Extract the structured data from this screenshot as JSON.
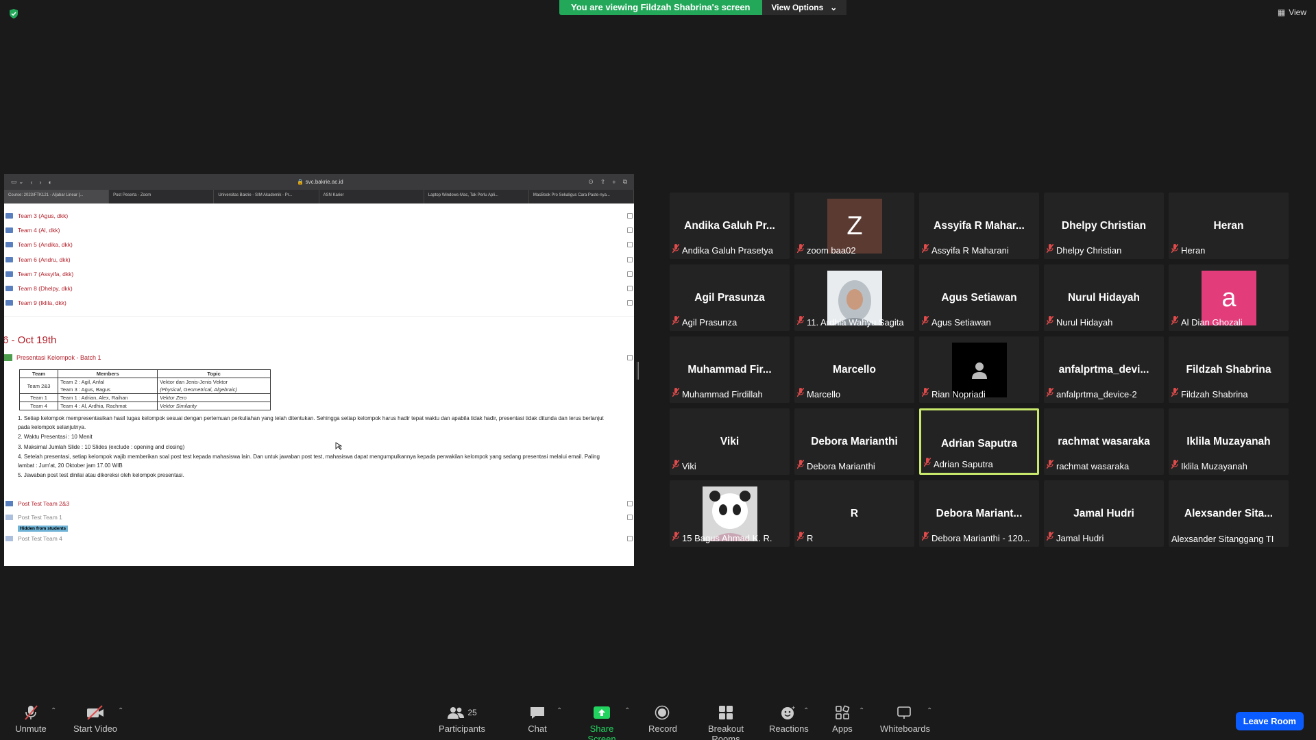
{
  "banner": {
    "viewing": "You are viewing Fildzah Shabrina's screen",
    "options": "View Options"
  },
  "view_label": "View",
  "browser": {
    "url": "svc.bakrie.ac.id",
    "tabs": [
      "Course: 2023/FTK121 - Aljabar Linear [...",
      "Post Peserta - Zoom",
      "Universitas Bakrie - SIM Akademik - Pr...",
      "ASN Karier",
      "Laptop Windows-Mac, Tak Perlu Apli...",
      "MacBook Pro Sekaligus Cara Paste-nya..."
    ]
  },
  "course": {
    "teams": [
      "Team 3 (Agus, dkk)",
      "Team 4 (Al, dkk)",
      "Team 5 (Andika, dkk)",
      "Team 6 (Andru, dkk)",
      "Team 7 (Assyifa, dkk)",
      "Team 8 (Dhelpy, dkk)",
      "Team 9 (Iklila, dkk)"
    ],
    "section_title": "6 - Oct 19th",
    "presentation_link": "Presentasi Kelompok - Batch 1",
    "table": {
      "headers": [
        "Team",
        "Members",
        "Topic"
      ],
      "rows": [
        {
          "team": "Team 2&3",
          "m1": "Team 2 : Agil, Anfal",
          "m2": "Team 3 : Agus, Bagus",
          "t1": "Vektor dan Jenis-Jenis Vektor",
          "t2": "(Physical, Geometrical, Algebraic)"
        },
        {
          "team": "Team 1",
          "m1": "Team 1 : Adrian, Alex, Raihan",
          "t1": "Vektor Zero"
        },
        {
          "team": "Team 4",
          "m1": "Team 4 : Al, Ardhia, Rachmat",
          "t1": "Vektor Similarity"
        }
      ]
    },
    "rules": [
      "1.  Setiap kelompok mempresentasikan hasil tugas kelompok sesuai dengan pertemuan perkuliahan yang telah ditentukan. Sehingga setiap kelompok harus hadir tepat waktu dan apabila tidak hadir, presentasi tidak ditunda dan terus berlanjut pada kelompok selanjutnya.",
      "2.  Waktu Presentasi : 10 Menit",
      "3.  Maksimal Jumlah Slide : 10 Slides (exclude : opening and closing)",
      "4.  Setelah presentasi, setiap kelompok wajib memberikan soal post test kepada mahasiswa lain. Dan untuk jawaban post test, mahasiswa dapat mengumpulkannya kepada perwakilan kelompok yang sedang presentasi melalui email. Paling lambat : Jum'at, 20 Oktober jam 17.00 WIB",
      "5.  Jawaban post test dinilai atau dikoreksi oleh kelompok presentasi."
    ],
    "post_tests": [
      "Post Test Team 2&3",
      "Post Test Team 1",
      "Post Test Team 4"
    ],
    "hidden_badge": "Hidden from students"
  },
  "participants": [
    {
      "big": "Andika Galuh Pr...",
      "label": "Andika Galuh Prasetya"
    },
    {
      "big": "",
      "label": "zoom baa02",
      "avatar": "Z",
      "avatar_color": "#5b3a32"
    },
    {
      "big": "Assyifa R Mahar...",
      "label": "Assyifa R Maharani"
    },
    {
      "big": "Dhelpy Christian",
      "label": "Dhelpy Christian"
    },
    {
      "big": "Heran",
      "label": "Heran"
    },
    {
      "big": "Agil Prasunza",
      "label": "Agil Prasunza"
    },
    {
      "big": "",
      "label": "11. Ardhia Wahyu Sagita",
      "avatar": "photo-person"
    },
    {
      "big": "Agus Setiawan",
      "label": "Agus Setiawan"
    },
    {
      "big": "Nurul Hidayah",
      "label": "Nurul Hidayah"
    },
    {
      "big": "",
      "label": "Al Dian Ghozali",
      "avatar": "a",
      "avatar_color": "#e23d7a"
    },
    {
      "big": "Muhammad Fir...",
      "label": "Muhammad Firdillah"
    },
    {
      "big": "Marcello",
      "label": "Marcello"
    },
    {
      "big": "",
      "label": "Rian Nopriadi",
      "avatar": "person-icon",
      "avatar_color": "#000000"
    },
    {
      "big": "anfalprtma_devi...",
      "label": "anfalprtma_device-2"
    },
    {
      "big": "Fildzah Shabrina",
      "label": "Fildzah Shabrina"
    },
    {
      "big": "Viki",
      "label": "Viki"
    },
    {
      "big": "Debora Marianthi",
      "label": "Debora Marianthi"
    },
    {
      "big": "Adrian Saputra",
      "label": "Adrian Saputra",
      "active": true
    },
    {
      "big": "rachmat wasaraka",
      "label": "rachmat wasaraka"
    },
    {
      "big": "Iklila Muzayanah",
      "label": "Iklila Muzayanah"
    },
    {
      "big": "",
      "label": "15 Bagus Ahmad K. R.",
      "avatar": "photo-panda"
    },
    {
      "big": "R",
      "label": "R"
    },
    {
      "big": "Debora  Mariant...",
      "label": "Debora Marianthi - 120..."
    },
    {
      "big": "Jamal Hudri",
      "label": "Jamal Hudri"
    },
    {
      "big": "Alexsander  Sita...",
      "label": "Alexsander Sitanggang TI",
      "unmuted": true
    }
  ],
  "toolbar": {
    "unmute": "Unmute",
    "start_video": "Start Video",
    "participants": "Participants",
    "participants_count": "25",
    "chat": "Chat",
    "share": "Share Screen",
    "record": "Record",
    "breakout": "Breakout Rooms",
    "reactions": "Reactions",
    "apps": "Apps",
    "whiteboards": "Whiteboards",
    "leave": "Leave Room"
  },
  "colors": {
    "banner_green": "#23a85a",
    "active_speaker": "#c8e86b",
    "leave_blue": "#0b5cff",
    "share_green": "#23d35f",
    "muted_red": "#e04a4a",
    "link_red": "#b2202a"
  }
}
